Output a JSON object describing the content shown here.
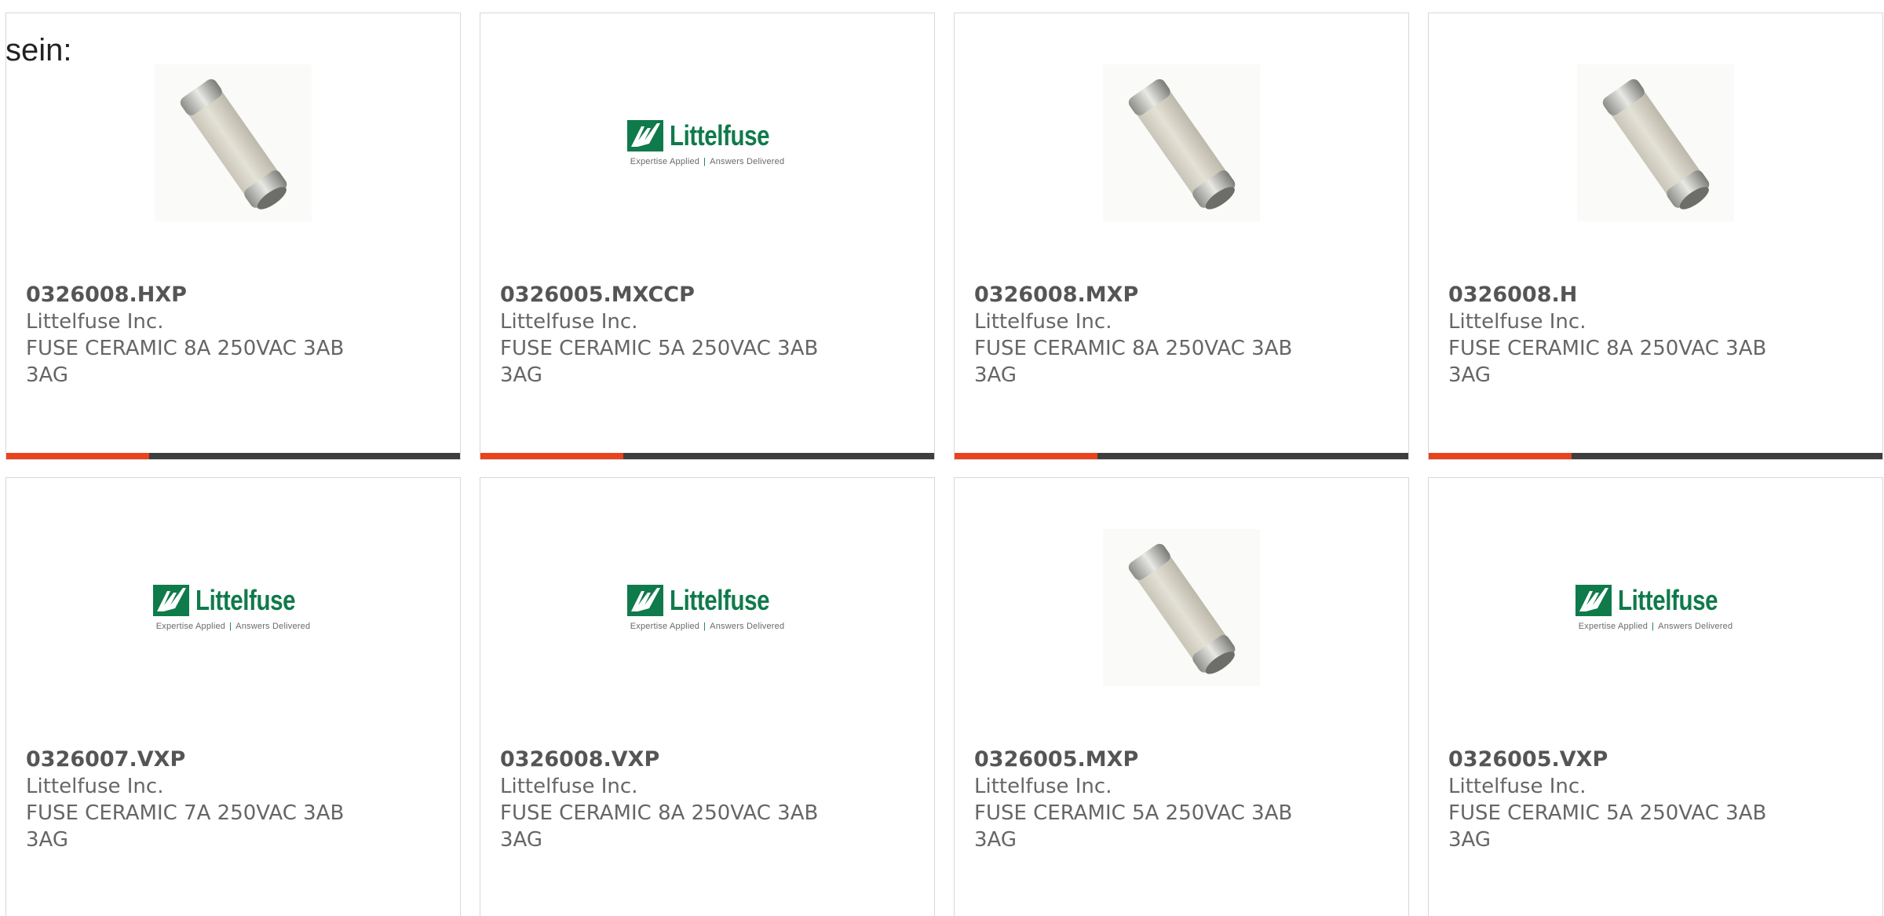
{
  "intro_text": "sein:",
  "brand": {
    "logo_name": "Littelfuse",
    "logo_tagline_left": "Expertise Applied",
    "logo_tagline_right": "Answers Delivered",
    "logo_color": "#0f7a4a",
    "accent_color": "#e8431c",
    "bar_color": "#3e3e3e"
  },
  "products": [
    {
      "part_number": "0326008.HXP",
      "manufacturer": "Littelfuse Inc.",
      "description_line1": "FUSE CERAMIC 8A 250VAC 3AB",
      "description_line2": "3AG",
      "image": "fuse-photo"
    },
    {
      "part_number": "0326005.MXCCP",
      "manufacturer": "Littelfuse Inc.",
      "description_line1": "FUSE CERAMIC 5A 250VAC 3AB",
      "description_line2": "3AG",
      "image": "littelfuse-logo"
    },
    {
      "part_number": "0326008.MXP",
      "manufacturer": "Littelfuse Inc.",
      "description_line1": "FUSE CERAMIC 8A 250VAC 3AB",
      "description_line2": "3AG",
      "image": "fuse-photo"
    },
    {
      "part_number": "0326008.H",
      "manufacturer": "Littelfuse Inc.",
      "description_line1": "FUSE CERAMIC 8A 250VAC 3AB",
      "description_line2": "3AG",
      "image": "fuse-photo"
    },
    {
      "part_number": "0326007.VXP",
      "manufacturer": "Littelfuse Inc.",
      "description_line1": "FUSE CERAMIC 7A 250VAC 3AB",
      "description_line2": "3AG",
      "image": "littelfuse-logo"
    },
    {
      "part_number": "0326008.VXP",
      "manufacturer": "Littelfuse Inc.",
      "description_line1": "FUSE CERAMIC 8A 250VAC 3AB",
      "description_line2": "3AG",
      "image": "littelfuse-logo"
    },
    {
      "part_number": "0326005.MXP",
      "manufacturer": "Littelfuse Inc.",
      "description_line1": "FUSE CERAMIC 5A 250VAC 3AB",
      "description_line2": "3AG",
      "image": "fuse-photo"
    },
    {
      "part_number": "0326005.VXP",
      "manufacturer": "Littelfuse Inc.",
      "description_line1": "FUSE CERAMIC 5A 250VAC 3AB",
      "description_line2": "3AG",
      "image": "littelfuse-logo"
    }
  ]
}
